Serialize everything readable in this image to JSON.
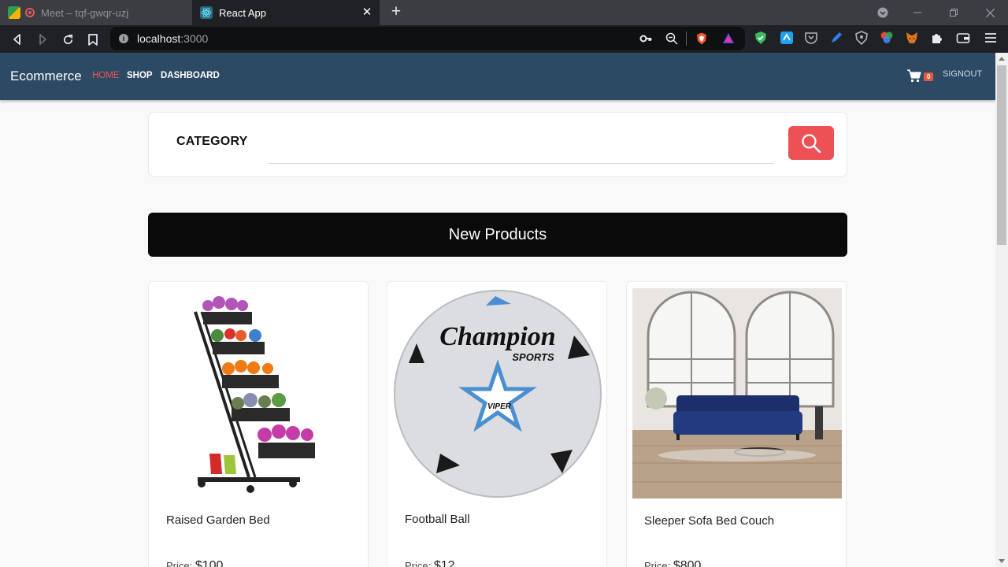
{
  "browser": {
    "tabs": [
      {
        "title": "Meet – tqf-gwqr-uzj",
        "active": false
      },
      {
        "title": "React App",
        "active": true
      }
    ],
    "address": {
      "host": "localhost",
      "port": ":3000"
    },
    "colors": {
      "tabstrip": "#3b3d42",
      "toolbar": "#202124"
    }
  },
  "navbar": {
    "brand": "Ecommerce",
    "links": [
      {
        "label": "HOME",
        "active": true,
        "color": "#ef5350"
      },
      {
        "label": "SHOP",
        "active": false,
        "color": "#ffffff"
      },
      {
        "label": "DASHBOARD",
        "active": false,
        "color": "#ffffff"
      }
    ],
    "cart_count": "0",
    "signout": "SIGNOUT",
    "bg": "#2d4a64"
  },
  "search": {
    "category_label": "CATEGORY",
    "input_value": "",
    "button_icon": "search-icon",
    "button_color": "#ee5155"
  },
  "banner": {
    "title": "New Products"
  },
  "products": [
    {
      "name": "Raised Garden Bed",
      "price_label": "Price",
      "price": "$100"
    },
    {
      "name": "Football Ball",
      "price_label": "Price",
      "price": "$12"
    },
    {
      "name": "Sleeper Sofa Bed Couch",
      "price_label": "Price",
      "price": "$800"
    }
  ]
}
